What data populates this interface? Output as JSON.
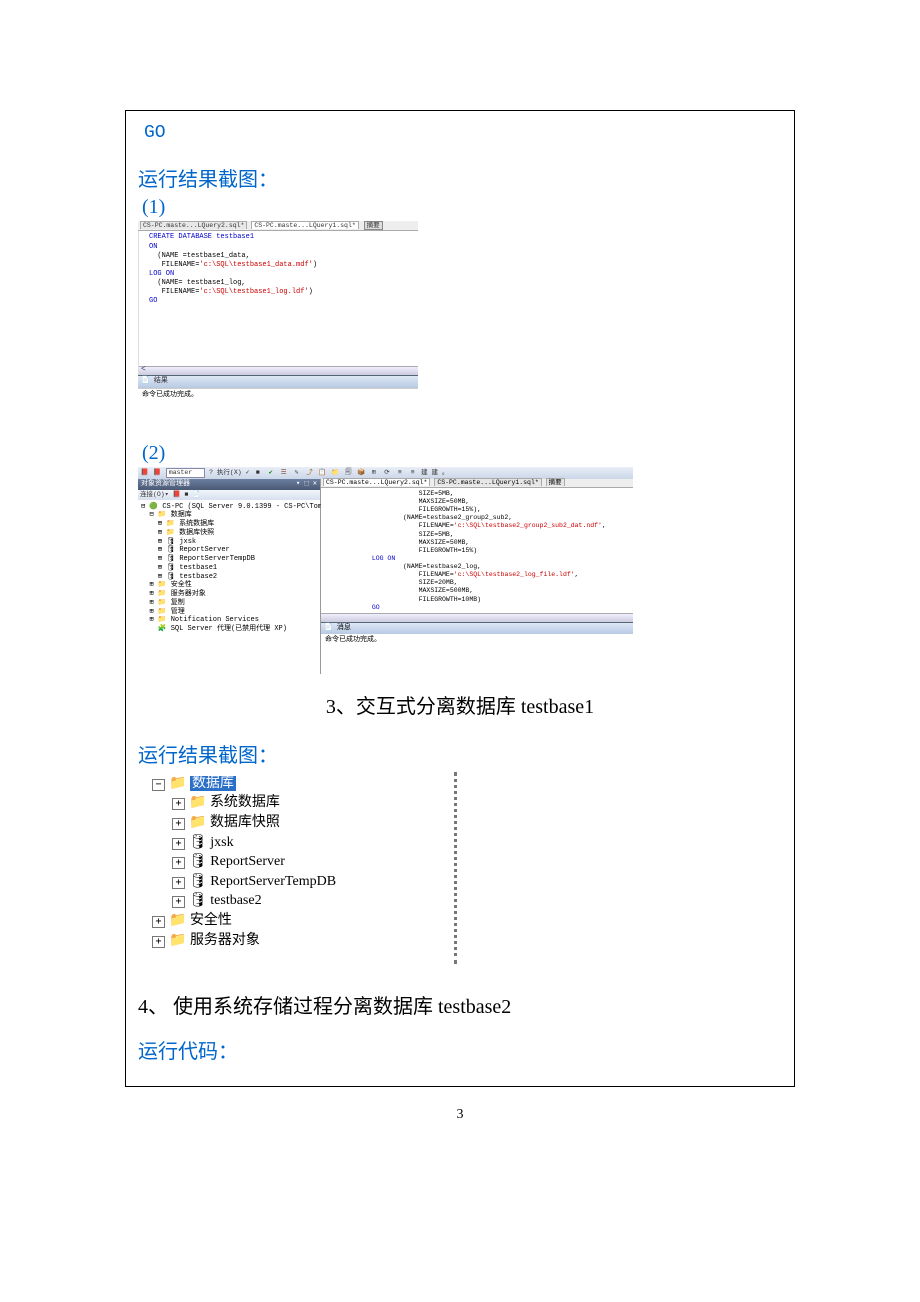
{
  "go_text": "GO",
  "sec1_title": "运行结果截图：",
  "sub1": "(1)",
  "sub2": "(2)",
  "ss1": {
    "tab1": "CS-PC.maste...LQuery2.sql*",
    "tab2": "CS-PC.maste...LQuery1.sql*",
    "tab_summary": "摘要",
    "code_l1": "CREATE DATABASE testbase1",
    "code_l2": "ON",
    "code_l3": "  (NAME =testbase1_data,",
    "code_l4a": "   FILENAME=",
    "code_l4b": "'c:\\SQL\\testbase1_data.mdf'",
    "code_l4c": ")",
    "code_l5": "LOG ON",
    "code_l6": "  (NAME= testbase1_log,",
    "code_l7a": "   FILENAME=",
    "code_l7b": "'c:\\SQL\\testbase1_log.ldf'",
    "code_l7c": ")",
    "code_l8": "GO",
    "result_tab": "📄 结果",
    "result_msg": "命令已成功完成。"
  },
  "ss2": {
    "combo_value": "master",
    "exec_label": "? 执行(X) ✓",
    "explorer_title": "对象资源管理器",
    "explorer_close": "▾ ⬚ ✕",
    "connect_label": "连接(O)▾ 📕 ■ 📄 🝸",
    "tree_root": "CS-PC (SQL Server 9.0.1399 - CS-PC\\Tom)",
    "tree_db": "数据库",
    "tree_sysdb": "系统数据库",
    "tree_snap": "数据库快照",
    "tree_jxsk": "jxsk",
    "tree_rs": "ReportServer",
    "tree_rst": "ReportServerTempDB",
    "tree_tb1": "testbase1",
    "tree_tb2": "testbase2",
    "tree_sec": "安全性",
    "tree_srv": "服务器对象",
    "tree_rep": "复制",
    "tree_mgmt": "管理",
    "tree_notif": "Notification Services",
    "tree_agent": "SQL Server 代理(已禁用代理 XP)",
    "tab1": "CS-PC.maste...LQuery2.sql*",
    "tab2": "CS-PC.maste...LQuery1.sql*",
    "tab_summary": "摘要",
    "c1": "SIZE=5MB,",
    "c2": "MAXSIZE=50MB,",
    "c3": "FILEGROWTH=15%),",
    "c4": "(NAME=testbase2_group2_sub2,",
    "c5a": "FILENAME=",
    "c5b": "'c:\\SQL\\testbase2_group2_sub2_dat.ndf'",
    "c5c": ",",
    "c6": "SIZE=5MB,",
    "c7": "MAXSIZE=50MB,",
    "c8": "FILEGROWTH=15%)",
    "c9": "LOG ON",
    "c10": "(NAME=testbase2_log,",
    "c11a": "FILENAME=",
    "c11b": "'c:\\SQL\\testbase2_log_file.ldf'",
    "c11c": ",",
    "c12": "SIZE=20MB,",
    "c13": "MAXSIZE=500MB,",
    "c14": "FILEGROWTH=10MB)",
    "c15": "GO",
    "res_tab": "📄 消息",
    "res_msg": "命令已成功完成。"
  },
  "heading3": "3、交互式分离数据库 testbase1",
  "sec3_title": "运行结果截图：",
  "ss3": {
    "db": "数据库",
    "sysdb": "系统数据库",
    "snap": "数据库快照",
    "jxsk": "jxsk",
    "rs": "ReportServer",
    "rst": "ReportServerTempDB",
    "tb2": "testbase2",
    "sec": "安全性",
    "srv": "服务器对象"
  },
  "heading4": "4、 使用系统存储过程分离数据库 testbase2",
  "run_code_label": "运行代码：",
  "page_num": "3"
}
